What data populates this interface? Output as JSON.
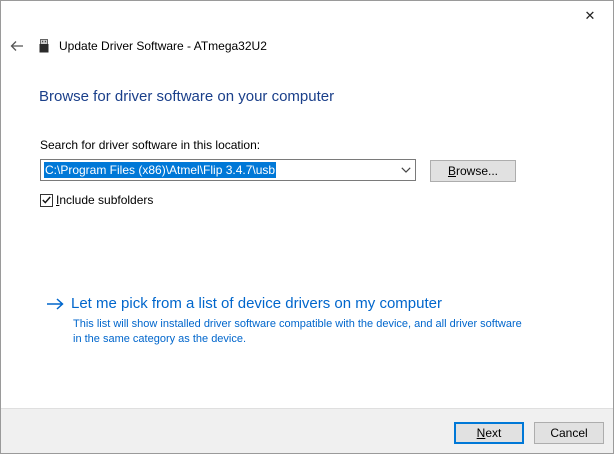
{
  "window": {
    "title": "Update Driver Software - ATmega32U2",
    "close_glyph": "✕",
    "back_glyph": "←"
  },
  "page": {
    "heading": "Browse for driver software on your computer",
    "search_label": "Search for driver software in this location:",
    "location_value": "C:\\Program Files (x86)\\Atmel\\Flip 3.4.7\\usb",
    "browse_label_accel": "B",
    "browse_label_rest": "rowse...",
    "include_subfolders_accel": "I",
    "include_subfolders_rest": "nclude subfolders",
    "include_subfolders_checked": true,
    "pick_link": "Let me pick from a list of device drivers on my computer",
    "pick_description": "This list will show installed driver software compatible with the device, and all driver software in the same category as the device."
  },
  "footer": {
    "next_accel": "N",
    "next_rest": "ext",
    "cancel_label": "Cancel"
  },
  "colors": {
    "heading": "#1a3f8a",
    "link": "#0066cc",
    "selection": "#0078d7",
    "footer_bg": "#f0f0f0"
  },
  "icons": {
    "back": "back-arrow-icon",
    "device": "usb-device-icon",
    "close": "close-icon",
    "dropdown": "chevron-down-icon",
    "pick": "arrow-right-icon",
    "check": "checkmark-icon"
  }
}
